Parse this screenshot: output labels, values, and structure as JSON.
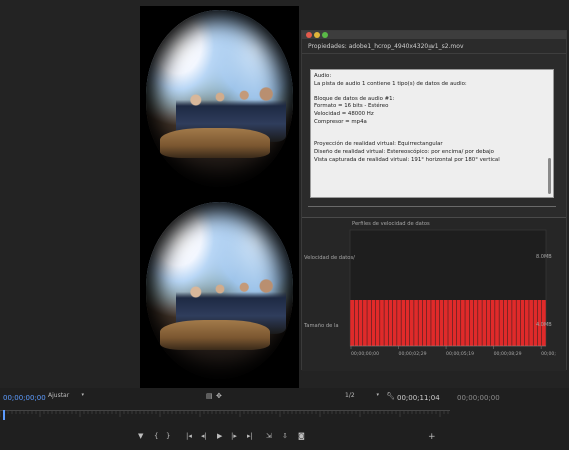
{
  "dialog": {
    "title": "Propiedades: adobe1_hcrop_4940x4320_v1_s2.mov",
    "menu_icon": "menu-icon",
    "info_text": "Audio:\nLa pista de audio 1 contiene 1 tipo(s) de datos de audio:\n\nBloque de datos de audio #1:\nFormato = 16 bits - Estéreo\nVelocidad = 48000 Hz\nCompresor = mp4a\n\n\nProyección de realidad virtual: Equirrectangular\nDiseño de realidad virtual: Estereoscópico: por encima/ por debajo\nVista capturada de realidad virtual: 191° horizontal por 180° vertical"
  },
  "chart_data": {
    "type": "bar",
    "title": "Perfiles de velocidad de datos",
    "left_labels": [
      "Velocidad de datos/",
      "Tamaño de la"
    ],
    "y_tick_top": "8.0MB",
    "y_tick_bottom": "4.0MB",
    "x_tick_labels": [
      "00;00;00;00",
      "00;00;02;29",
      "00;00;05;19",
      "00;00;08;29",
      "00;00;"
    ],
    "bar_color": "#e02a2a",
    "values": [
      4,
      4,
      4,
      4,
      4,
      4,
      4,
      4,
      4,
      4,
      4,
      4,
      4,
      4,
      4,
      4,
      4,
      4,
      4,
      4,
      4,
      4,
      4,
      4,
      4,
      4,
      4,
      4,
      4,
      4,
      4,
      4,
      4,
      4,
      4,
      4,
      4,
      4,
      4,
      4,
      4,
      4,
      4,
      4,
      4,
      4
    ],
    "ylim": [
      0,
      8
    ]
  },
  "bottom": {
    "timecode_left": "00;00;00;00",
    "zoom_label": "Ajustar",
    "resolution_label": "1/2",
    "timecode_right": "00;00;11;04",
    "timecode_far_right": "00;00;00;00"
  },
  "controls": [
    "marker-icon",
    "in-point-icon",
    "out-point-icon",
    "go-to-in-icon",
    "step-back-icon",
    "play-icon",
    "step-forward-icon",
    "go-to-out-icon",
    "insert-icon",
    "overwrite-icon",
    "export-frame-icon"
  ],
  "colors": {
    "accent": "#5d9cff",
    "bar": "#e02a2a"
  }
}
